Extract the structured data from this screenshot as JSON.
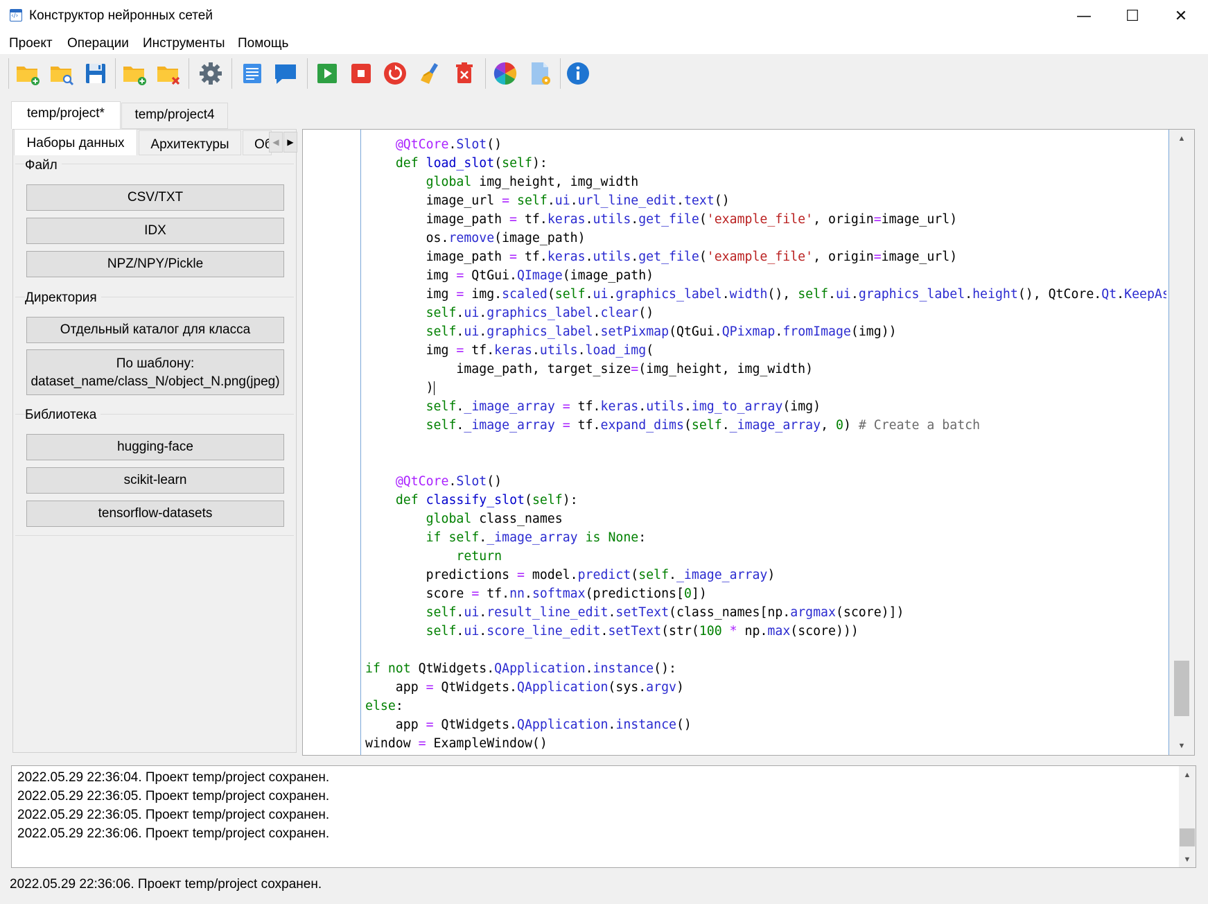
{
  "window": {
    "title": "Конструктор нейронных сетей",
    "icon": "app-code-icon",
    "controls": [
      "minimize-icon",
      "maximize-icon",
      "close-icon"
    ],
    "minimize_glyph": "—",
    "maximize_glyph": "☐",
    "close_glyph": "✕"
  },
  "menu": [
    "Проект",
    "Операции",
    "Инструменты",
    "Помощь"
  ],
  "toolbar": {
    "icons": [
      "new-project-icon",
      "open-project-icon",
      "save-icon",
      "add-folder-icon",
      "delete-folder-icon",
      "settings-icon",
      "document-icon",
      "chat-icon",
      "run-icon",
      "stop-icon",
      "restart-icon",
      "clean-icon",
      "delete-icon",
      "color-palette-icon",
      "file-settings-icon",
      "info-icon"
    ]
  },
  "project_tabs": [
    "temp/project*",
    "temp/project4"
  ],
  "left_tabs": [
    "Наборы данных",
    "Архитектуры",
    "Об"
  ],
  "left_arrows": {
    "left": "◀",
    "right": "▶"
  },
  "datasets": {
    "file": {
      "title": "Файл",
      "buttons": [
        "CSV/TXT",
        "IDX",
        "NPZ/NPY/Pickle"
      ]
    },
    "directory": {
      "title": "Директория",
      "buttons": [
        "Отдельный каталог для класса"
      ],
      "template_line1": "По шаблону:",
      "template_line2": "dataset_name/class_N/object_N.png(jpeg)"
    },
    "library": {
      "title": "Библиотека",
      "buttons": [
        "hugging-face",
        "scikit-learn",
        "tensorflow-datasets"
      ]
    }
  },
  "code_lines": [
    "    @QtCore.Slot()",
    "    def load_slot(self):",
    "        global img_height, img_width",
    "        image_url = self.ui.url_line_edit.text()",
    "        image_path = tf.keras.utils.get_file('example_file', origin=image_url)",
    "        os.remove(image_path)",
    "        image_path = tf.keras.utils.get_file('example_file', origin=image_url)",
    "        img = QtGui.QImage(image_path)",
    "        img = img.scaled(self.ui.graphics_label.width(), self.ui.graphics_label.height(), QtCore.Qt.KeepAspe",
    "        self.ui.graphics_label.clear()",
    "        self.ui.graphics_label.setPixmap(QtGui.QPixmap.fromImage(img))",
    "        img = tf.keras.utils.load_img(",
    "            image_path, target_size=(img_height, img_width)",
    "        )",
    "        self._image_array = tf.keras.utils.img_to_array(img)",
    "        self._image_array = tf.expand_dims(self._image_array, 0) # Create a batch",
    "",
    "",
    "    @QtCore.Slot()",
    "    def classify_slot(self):",
    "        global class_names",
    "        if self._image_array is None:",
    "            return",
    "        predictions = model.predict(self._image_array)",
    "        score = tf.nn.softmax(predictions[0])",
    "        self.ui.result_line_edit.setText(class_names[np.argmax(score)])",
    "        self.ui.score_line_edit.setText(str(100 * np.max(score)))",
    "",
    "if not QtWidgets.QApplication.instance():",
    "    app = QtWidgets.QApplication(sys.argv)",
    "else:",
    "    app = QtWidgets.QApplication.instance()",
    "window = ExampleWindow()"
  ],
  "scroll_arrows": {
    "up": "▲",
    "down": "▼"
  },
  "log": [
    "2022.05.29 22:36:04. Проект temp/project сохранен.",
    "2022.05.29 22:36:05. Проект temp/project сохранен.",
    "2022.05.29 22:36:05. Проект temp/project сохранен.",
    "2022.05.29 22:36:06. Проект temp/project сохранен."
  ],
  "status": "2022.05.29 22:36:06. Проект temp/project сохранен."
}
